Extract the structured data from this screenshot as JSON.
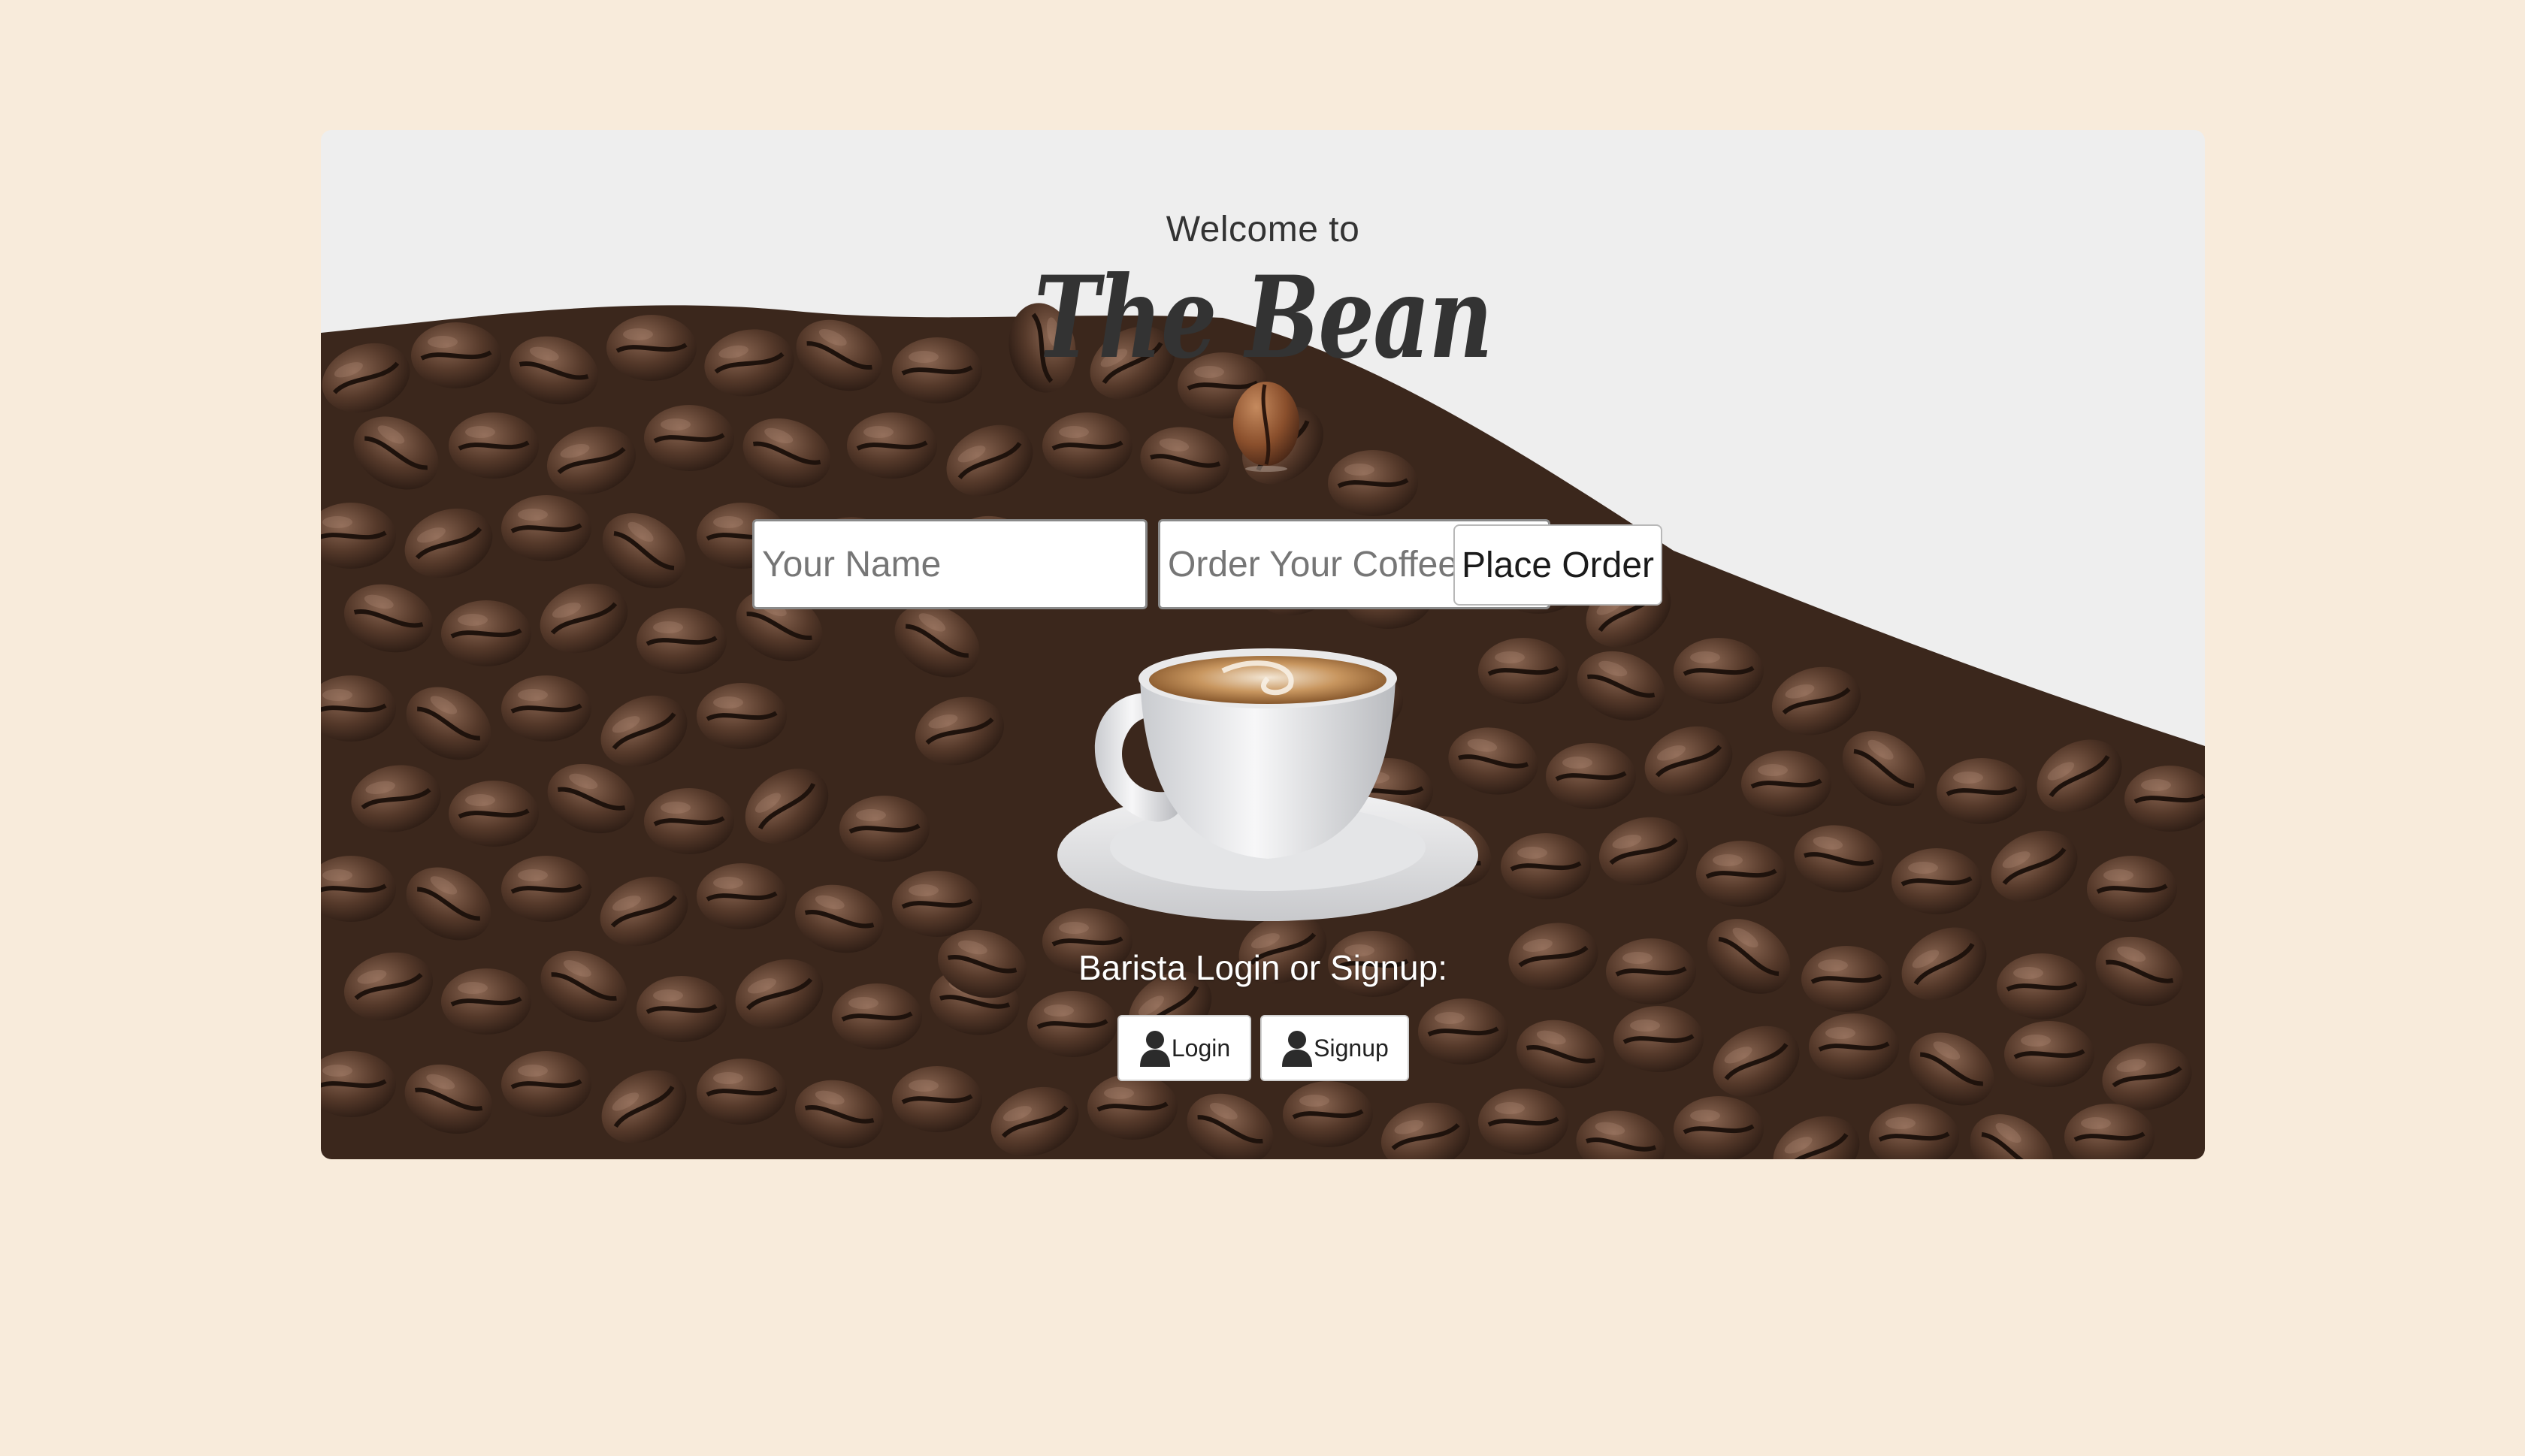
{
  "header": {
    "welcome_text": "Welcome to",
    "brand_name": "The Bean"
  },
  "order_form": {
    "name_placeholder": "Your Name",
    "order_placeholder": "Order Your Coffee Here",
    "submit_label": "Place Order"
  },
  "barista": {
    "prompt": "Barista Login or Signup:",
    "login_label": "Login",
    "signup_label": "Signup",
    "icon": "user-icon"
  },
  "colors": {
    "page_background": "#f8ebdb",
    "card_background": "#eeeeee",
    "text_dark": "#333333",
    "bean_brown": "#4a3224"
  }
}
